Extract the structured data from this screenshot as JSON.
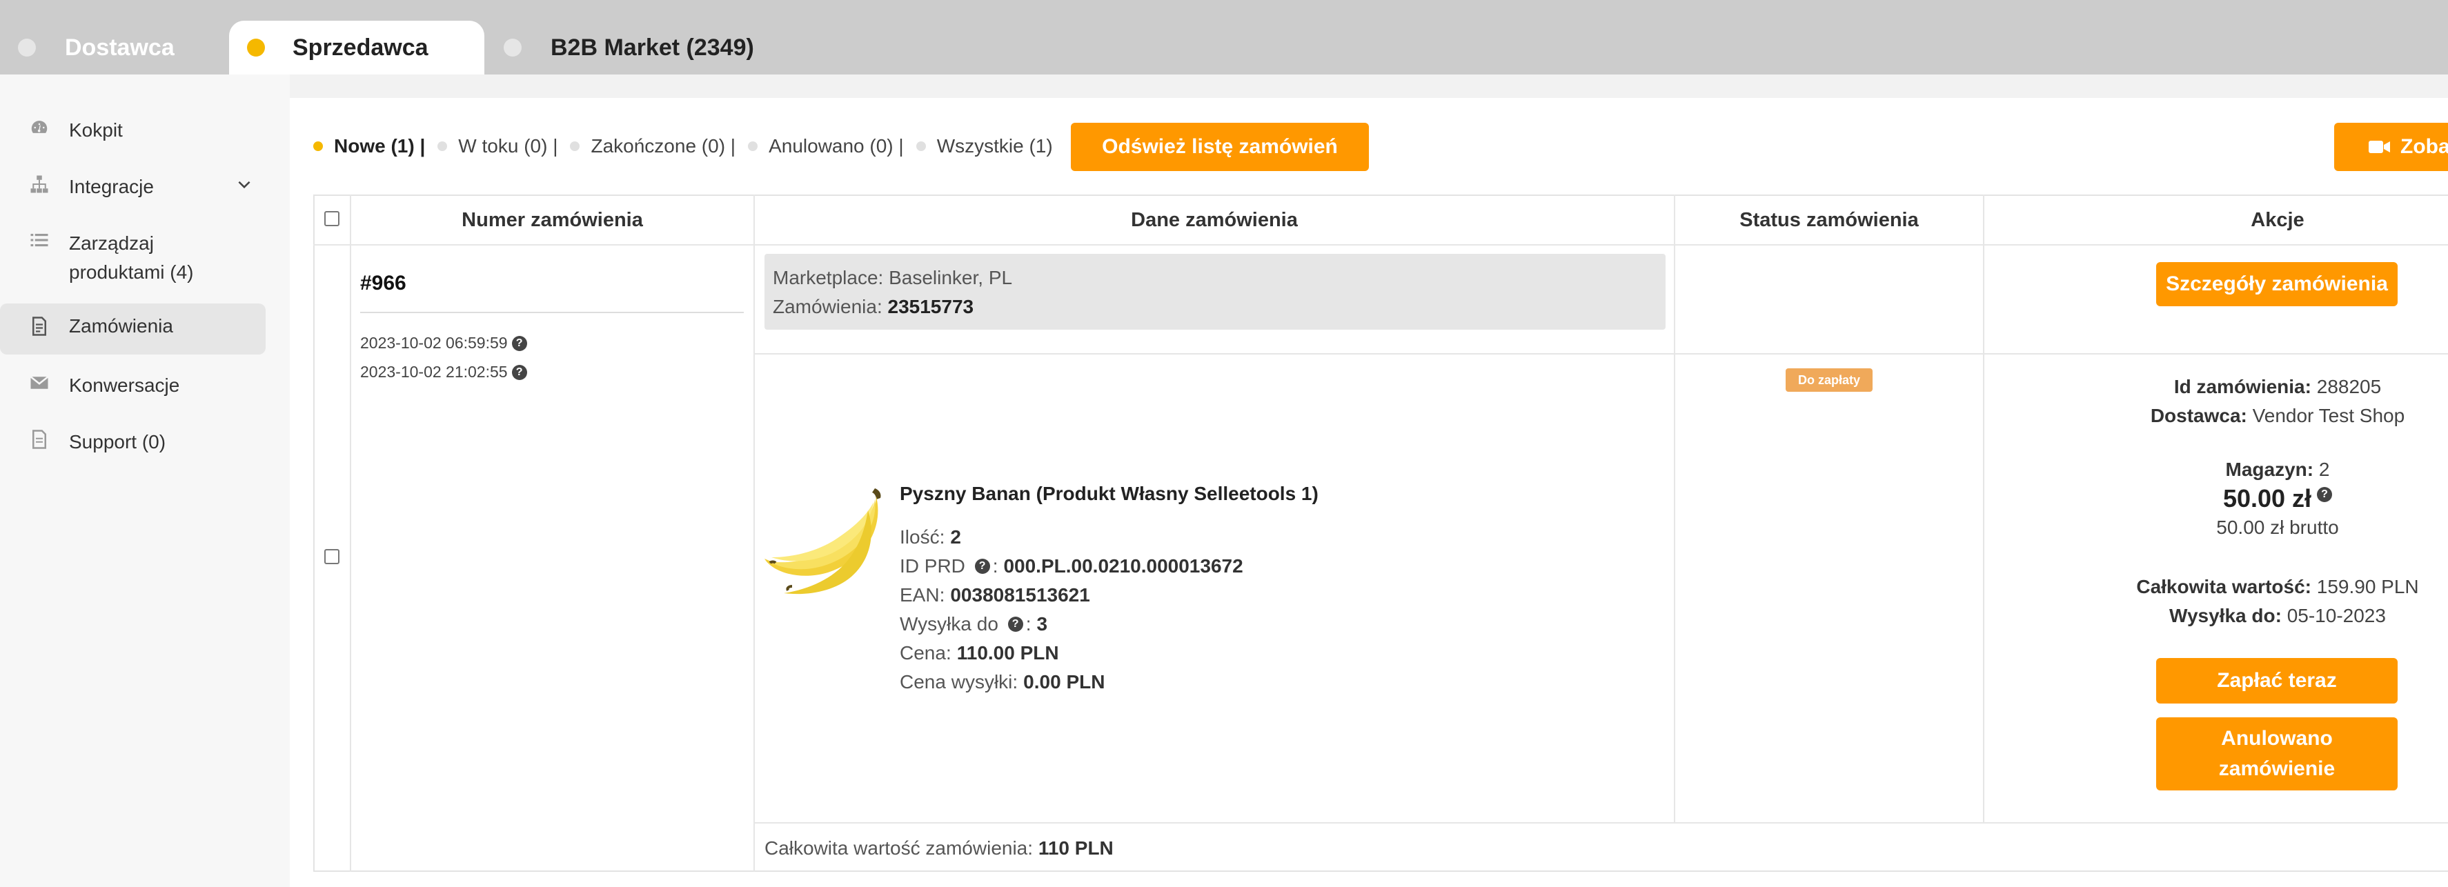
{
  "tabs": [
    {
      "label": "Dostawca"
    },
    {
      "label": "Sprzedawca"
    },
    {
      "label": "B2B Market (2349)"
    }
  ],
  "sidebar": {
    "items": [
      {
        "label": "Kokpit",
        "icon": "dashboard-icon"
      },
      {
        "label": "Integracje",
        "icon": "sitemap-icon"
      },
      {
        "label": "Zarządzaj",
        "label2": "produktami (4)",
        "icon": "list-icon"
      },
      {
        "label": "Zamówienia",
        "icon": "document-icon"
      },
      {
        "label": "Konwersacje",
        "icon": "envelope-icon"
      },
      {
        "label": "Support (0)",
        "icon": "file-icon"
      }
    ]
  },
  "filters": [
    {
      "label": "Nowe (1) |"
    },
    {
      "label": "W toku (0) |"
    },
    {
      "label": "Zakończone (0) |"
    },
    {
      "label": "Anulowano (0) |"
    },
    {
      "label": "Wszystkie (1)"
    }
  ],
  "buttons": {
    "refresh": "Odśwież listę zamówień",
    "video": "Zoba",
    "details": "Szczegóły zamówienia",
    "pay": "Zapłać teraz",
    "cancel_line1": "Anulowano",
    "cancel_line2": "zamówienie"
  },
  "table": {
    "headers": {
      "number": "Numer zamówienia",
      "data": "Dane zamówienia",
      "status": "Status zamówienia",
      "actions": "Akcje"
    }
  },
  "order": {
    "number": "#966",
    "dates": [
      "2023-10-02 06:59:59",
      "2023-10-02 21:02:55"
    ],
    "marketplace_label": "Marketplace:",
    "marketplace_value": "Baselinker, PL",
    "orders_label": "Zamówienia:",
    "orders_value": "23515773",
    "status_badge": "Do zapłaty",
    "product": {
      "name": "Pyszny Banan (Produkt Własny Selleetools 1)",
      "qty_label": "Ilość:",
      "qty_value": "2",
      "idprd_label": "ID PRD",
      "idprd_value": "000.PL.00.0210.000013672",
      "ean_label": "EAN:",
      "ean_value": "0038081513621",
      "ship_label": "Wysyłka do",
      "ship_value": "3",
      "price_label": "Cena:",
      "price_value": "110.00 PLN",
      "ship_price_label": "Cena wysyłki:",
      "ship_price_value": "0.00 PLN"
    },
    "actions": {
      "id_label": "Id zamówienia:",
      "id_value": "288205",
      "vendor_label": "Dostawca:",
      "vendor_value": "Vendor Test Shop",
      "warehouse_label": "Magazyn:",
      "warehouse_value": "2",
      "price": "50.00 zł",
      "price_gross": "50.00 zł brutto",
      "total_label": "Całkowita wartość:",
      "total_value": "159.90 PLN",
      "ship_label": "Wysyłka do:",
      "ship_value": "05-10-2023"
    },
    "total_label": "Całkowita wartość zamówienia:",
    "total_value": "110 PLN"
  },
  "colors": {
    "accent": "#ff9800",
    "active_dot": "#f5b800",
    "badge": "#f0a95a"
  }
}
